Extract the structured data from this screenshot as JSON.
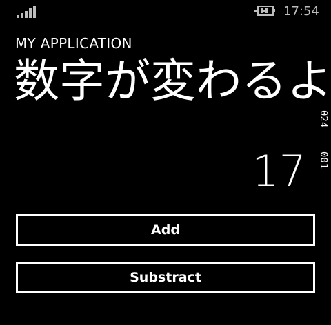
{
  "status_bar": {
    "signal_icon": "signal-strength-icon",
    "battery_icon": "battery-charging-icon",
    "time": "17:54"
  },
  "app": {
    "title": "MY APPLICATION",
    "page_title": "数字が変わるよ"
  },
  "side_counter": {
    "top": "024",
    "bottom": "001"
  },
  "counter": {
    "value": "17"
  },
  "buttons": {
    "add_label": "Add",
    "subtract_label": "Substract"
  },
  "colors": {
    "background": "#000000",
    "foreground": "#ffffff",
    "status": "#bdbdbd"
  }
}
